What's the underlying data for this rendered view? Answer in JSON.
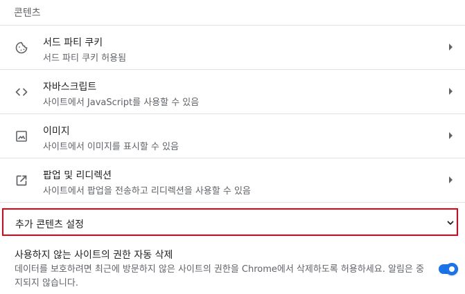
{
  "section": {
    "title": "콘텐츠"
  },
  "rows": [
    {
      "label": "서드 파티 쿠키",
      "sublabel": "서드 파티 쿠키 허용됨",
      "icon": "cookie-icon"
    },
    {
      "label": "자바스크립트",
      "sublabel": "사이트에서 JavaScript를 사용할 수 있음",
      "icon": "code-icon"
    },
    {
      "label": "이미지",
      "sublabel": "사이트에서 이미지를 표시할 수 있음",
      "icon": "image-icon"
    },
    {
      "label": "팝업 및 리디렉션",
      "sublabel": "사이트에서 팝업을 전송하고 리디렉션을 사용할 수 있음",
      "icon": "open-in-new-icon"
    }
  ],
  "advanced": {
    "label": "추가 콘텐츠 설정",
    "icon": "chevron-down-icon",
    "highlight_color": "#e3000f"
  },
  "auto_revoke": {
    "title": "사용하지 않는 사이트의 권한 자동 삭제",
    "description": "데이터를 보호하려면 최근에 방문하지 않은 사이트의 권한을 Chrome에서 삭제하도록 허용하세요. 알림은 중지되지 않습니다.",
    "toggle_on": true,
    "accent_color": "#1a73e8"
  }
}
